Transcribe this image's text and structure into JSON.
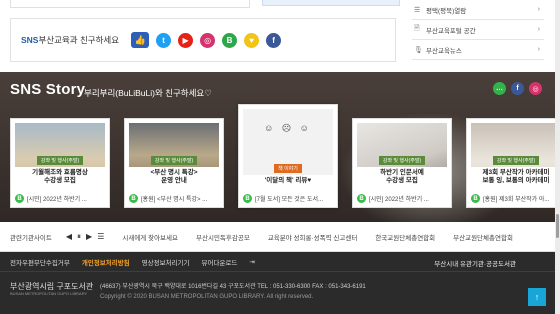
{
  "sns_bar": {
    "label_prefix": "SNS",
    "label_rest": "부산교육과 친구하세요",
    "icons": [
      {
        "name": "twitter-icon",
        "glyph": "t",
        "color": "#1da1f2"
      },
      {
        "name": "youtube-icon",
        "glyph": "▶",
        "color": "#e62117"
      },
      {
        "name": "instagram-icon",
        "glyph": "◎",
        "color": "#d6336c"
      },
      {
        "name": "blog-icon",
        "glyph": "B",
        "color": "#2ca84a"
      },
      {
        "name": "idea-icon",
        "glyph": "♥",
        "color": "#f2c418"
      },
      {
        "name": "facebook-icon",
        "glyph": "f",
        "color": "#3b5998"
      }
    ]
  },
  "side_links": [
    {
      "label": "평택(평북)열람"
    },
    {
      "label": "부산교육포털 공간"
    },
    {
      "label": "부산교육뉴스"
    }
  ],
  "story": {
    "title": "SNS Story",
    "subtitle": "부리부리(BuLiBuLi)와 친구하세요♡",
    "social": [
      {
        "name": "kakao-icon",
        "glyph": "…",
        "color": "#34b24a"
      },
      {
        "name": "facebook-icon",
        "glyph": "f",
        "color": "#3b5998"
      },
      {
        "name": "instagram-icon",
        "glyph": "◎",
        "color": "#d6336c"
      }
    ],
    "cards": [
      {
        "tag": "강좌 및 행사(주말)",
        "caption": "기월해조와 효름명상\n수강생 모집",
        "foot": "[시민] 2022년 하반기 ..."
      },
      {
        "tag": "강좌 및 행사(주말)",
        "caption": "<부산 명시 특강>\n운영 안내",
        "foot": "[홍원] <부산 명시 특강> ..."
      },
      {
        "tag": "책 이야기",
        "caption": "'이달의 책' 리뷰♥",
        "foot": "[7월 도서] 모든 것은 도서..."
      },
      {
        "tag": "강좌 및 행사(주말)",
        "caption": "하반기 인문서예\n수강생 모집",
        "foot": "[시민] 2022년 하반기 ..."
      },
      {
        "tag": "강좌 및 행사(주말)",
        "caption": "제3회 부산작가 아카데미\n보통 잉, 보통의 아카데미",
        "foot": "[홍원] 제3회 부산작가 아..."
      }
    ]
  },
  "quick": {
    "title": "관련기관사이트",
    "controls": [
      "◀",
      "⏸",
      "▶",
      "☰"
    ],
    "items": [
      "시새에게 찾아보세요",
      "부산시민독후감공모",
      "교육분야 성희롱·성폭력 신고센터",
      "한국교원단체총연합회",
      "부산교원단체총연합회"
    ]
  },
  "footer": {
    "menu": [
      "전자우편무단수집거부",
      "개인정보처리방침",
      "영상정보처리기기",
      "뷰어다운로드",
      "⇥"
    ],
    "right": "부산시내 유관기관·공공도서관",
    "logo_kr": "부산광역시립 구포도서관",
    "logo_en": "BUSAN METROPOLITAN GUPO LIBRARY",
    "address": "(46637) 부산광역시 북구 백양대로 1016번다길 43 구포도서관 TEL : 051-330-6300 FAX : 051-343-6191",
    "copyright": "Copyright © 2020 BUSAN METROPOLITAN GUPO LIBRARY. All right reserved.",
    "top_button": "↑"
  }
}
